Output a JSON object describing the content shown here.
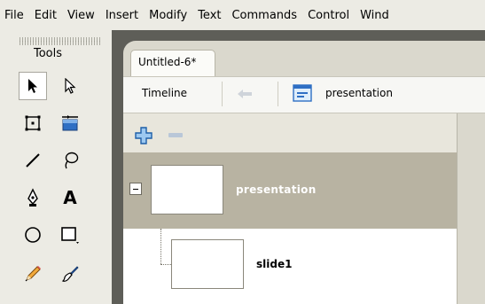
{
  "menubar": {
    "items": [
      "File",
      "Edit",
      "View",
      "Insert",
      "Modify",
      "Text",
      "Commands",
      "Control",
      "Wind"
    ]
  },
  "tools": {
    "title": "Tools",
    "items": [
      "selection-tool",
      "subselection-tool",
      "free-transform-tool",
      "gradient-transform-tool",
      "line-tool",
      "lasso-tool",
      "pen-tool",
      "text-tool",
      "oval-tool",
      "rectangle-tool",
      "pencil-tool",
      "brush-tool"
    ],
    "active": "selection-tool"
  },
  "document": {
    "tab_title": "Untitled-6*"
  },
  "timeline_bar": {
    "timeline_label": "Timeline",
    "scene_label": "presentation"
  },
  "tree": {
    "nodes": [
      {
        "label": "presentation",
        "selected": true,
        "expanded": true
      },
      {
        "label": "slide1",
        "selected": false
      }
    ]
  },
  "colors": {
    "chrome": "#ecebe4",
    "dark_strip": "#5e5e58",
    "selected_row": "#b8b3a2",
    "accent_blue": "#2f6fc4"
  }
}
